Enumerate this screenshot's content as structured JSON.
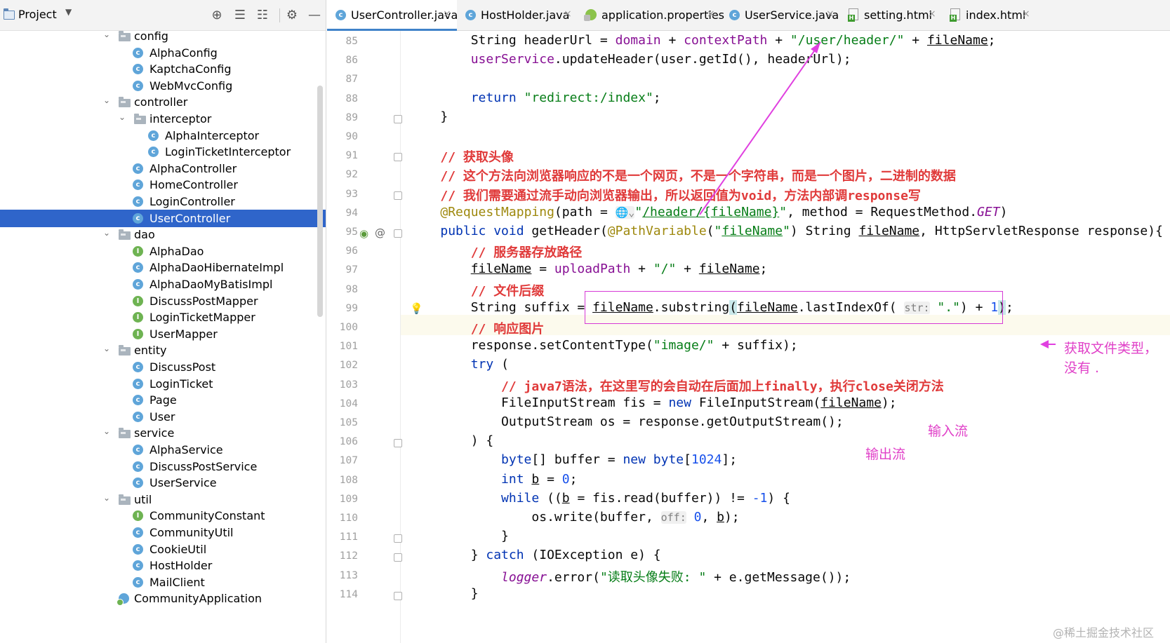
{
  "project_panel": {
    "title": "Project",
    "dropdown": "▼",
    "toolbar": [
      {
        "name": "locate-icon",
        "glyph": "⊕"
      },
      {
        "name": "expand-all-icon",
        "glyph": "☰"
      },
      {
        "name": "collapse-all-icon",
        "glyph": "☷"
      },
      {
        "name": "gear-icon",
        "glyph": "⚙"
      },
      {
        "name": "minimize-icon",
        "glyph": "—"
      }
    ],
    "tree": [
      {
        "label": "config",
        "type": "folder",
        "level": 1,
        "expanded": true
      },
      {
        "label": "AlphaConfig",
        "type": "class",
        "level": 2
      },
      {
        "label": "KaptchaConfig",
        "type": "class",
        "level": 2
      },
      {
        "label": "WebMvcConfig",
        "type": "class",
        "level": 2
      },
      {
        "label": "controller",
        "type": "folder",
        "level": 1,
        "expanded": true
      },
      {
        "label": "interceptor",
        "type": "folder",
        "level": 2,
        "expanded": true
      },
      {
        "label": "AlphaInterceptor",
        "type": "class",
        "level": 3
      },
      {
        "label": "LoginTicketInterceptor",
        "type": "class",
        "level": 3
      },
      {
        "label": "AlphaController",
        "type": "class",
        "level": 2
      },
      {
        "label": "HomeController",
        "type": "class",
        "level": 2
      },
      {
        "label": "LoginController",
        "type": "class",
        "level": 2
      },
      {
        "label": "UserController",
        "type": "class",
        "level": 2,
        "selected": true
      },
      {
        "label": "dao",
        "type": "folder",
        "level": 1,
        "expanded": true
      },
      {
        "label": "AlphaDao",
        "type": "interface",
        "level": 2
      },
      {
        "label": "AlphaDaoHibernateImpl",
        "type": "class",
        "level": 2
      },
      {
        "label": "AlphaDaoMyBatisImpl",
        "type": "class",
        "level": 2
      },
      {
        "label": "DiscussPostMapper",
        "type": "interface",
        "level": 2
      },
      {
        "label": "LoginTicketMapper",
        "type": "interface",
        "level": 2
      },
      {
        "label": "UserMapper",
        "type": "interface",
        "level": 2
      },
      {
        "label": "entity",
        "type": "folder",
        "level": 1,
        "expanded": true
      },
      {
        "label": "DiscussPost",
        "type": "class",
        "level": 2
      },
      {
        "label": "LoginTicket",
        "type": "class",
        "level": 2
      },
      {
        "label": "Page",
        "type": "class",
        "level": 2
      },
      {
        "label": "User",
        "type": "class",
        "level": 2
      },
      {
        "label": "service",
        "type": "folder",
        "level": 1,
        "expanded": true
      },
      {
        "label": "AlphaService",
        "type": "class",
        "level": 2
      },
      {
        "label": "DiscussPostService",
        "type": "class",
        "level": 2
      },
      {
        "label": "UserService",
        "type": "class",
        "level": 2
      },
      {
        "label": "util",
        "type": "folder",
        "level": 1,
        "expanded": true
      },
      {
        "label": "CommunityConstant",
        "type": "interface",
        "level": 2
      },
      {
        "label": "CommunityUtil",
        "type": "class",
        "level": 2
      },
      {
        "label": "CookieUtil",
        "type": "class",
        "level": 2
      },
      {
        "label": "HostHolder",
        "type": "class",
        "level": 2
      },
      {
        "label": "MailClient",
        "type": "class",
        "level": 2
      },
      {
        "label": "CommunityApplication",
        "type": "app",
        "level": 1
      }
    ]
  },
  "tabs": [
    {
      "label": "UserController.java",
      "icon": "class",
      "active": true
    },
    {
      "label": "HostHolder.java",
      "icon": "class"
    },
    {
      "label": "application.properties",
      "icon": "properties"
    },
    {
      "label": "UserService.java",
      "icon": "class"
    },
    {
      "label": "setting.html",
      "icon": "html"
    },
    {
      "label": "index.html",
      "icon": "html"
    }
  ],
  "editor": {
    "lines": [
      {
        "n": "85",
        "code": [
          [
            "",
            "        String headerUrl = "
          ],
          [
            "fld",
            "domain"
          ],
          [
            "",
            " + "
          ],
          [
            "fld",
            "contextPath"
          ],
          [
            "",
            " + "
          ],
          [
            "str",
            "\"/user/header/\""
          ],
          [
            "",
            " + "
          ],
          [
            "ul",
            "fileName"
          ],
          [
            "",
            ";"
          ]
        ]
      },
      {
        "n": "86",
        "code": [
          [
            "",
            "        "
          ],
          [
            "fld",
            "userService"
          ],
          [
            "",
            ".updateHeader(user.getId(), headerUrl);"
          ]
        ]
      },
      {
        "n": "87",
        "code": [
          [
            "",
            ""
          ]
        ]
      },
      {
        "n": "88",
        "code": [
          [
            "",
            "        "
          ],
          [
            "kw",
            "return "
          ],
          [
            "str",
            "\"redirect:/index\""
          ],
          [
            "",
            ";"
          ]
        ]
      },
      {
        "n": "89",
        "code": [
          [
            "",
            "    }"
          ]
        ]
      },
      {
        "n": "90",
        "code": [
          [
            "",
            ""
          ]
        ]
      },
      {
        "n": "91",
        "code": [
          [
            "",
            "    "
          ],
          [
            "cmt",
            "// 获取头像"
          ]
        ]
      },
      {
        "n": "92",
        "code": [
          [
            "",
            "    "
          ],
          [
            "cmt",
            "// 这个方法向浏览器响应的不是一个网页，不是一个字符串，而是一个图片，二进制的数据"
          ]
        ]
      },
      {
        "n": "93",
        "code": [
          [
            "",
            "    "
          ],
          [
            "cmt",
            "// 我们需要通过流手动向浏览器输出，所以返回值为void，方法内部调response写"
          ]
        ]
      },
      {
        "n": "94",
        "code": [
          [
            "",
            "    "
          ],
          [
            "ann",
            "@RequestMapping"
          ],
          [
            "",
            "(path = "
          ],
          [
            "hint",
            "🌐⌄"
          ],
          [
            "str",
            "\""
          ],
          [
            "str ul",
            "/header/{fileName}"
          ],
          [
            "str",
            "\""
          ],
          [
            "",
            ", method = RequestMethod."
          ],
          [
            "fld it",
            "GET"
          ],
          [
            "",
            ")"
          ]
        ]
      },
      {
        "n": "95",
        "code": [
          [
            "",
            "    "
          ],
          [
            "kw",
            "public void "
          ],
          [
            "",
            "getHeader("
          ],
          [
            "ann",
            "@PathVariable"
          ],
          [
            "",
            "("
          ],
          [
            "str",
            "\""
          ],
          [
            "str ul",
            "fileName"
          ],
          [
            "str",
            "\""
          ],
          [
            "",
            ") String "
          ],
          [
            "ul",
            "fileName"
          ],
          [
            "",
            ", HttpServletResponse response){"
          ]
        ]
      },
      {
        "n": "96",
        "code": [
          [
            "",
            "        "
          ],
          [
            "cmt",
            "// 服务器存放路径"
          ]
        ]
      },
      {
        "n": "97",
        "code": [
          [
            "",
            "        "
          ],
          [
            "ul",
            "fileName"
          ],
          [
            "",
            " = "
          ],
          [
            "fld",
            "uploadPath"
          ],
          [
            "",
            " + "
          ],
          [
            "str",
            "\"/\""
          ],
          [
            "",
            " + "
          ],
          [
            "ul",
            "fileName"
          ],
          [
            "",
            ";"
          ]
        ]
      },
      {
        "n": "98",
        "code": [
          [
            "",
            "        "
          ],
          [
            "cmt",
            "// 文件后缀"
          ]
        ]
      },
      {
        "n": "99",
        "code": [
          [
            "",
            "        String suffix = "
          ],
          [
            "ul",
            "fileName"
          ],
          [
            "",
            ".substring"
          ],
          [
            "brace-hl",
            "("
          ],
          [
            "ul",
            "fileName"
          ],
          [
            "",
            ".lastIndexOf( "
          ],
          [
            "hint",
            "str:"
          ],
          [
            "",
            ""
          ],
          [
            "str",
            " \".\""
          ],
          [
            "",
            ") + "
          ],
          [
            "num",
            "1"
          ],
          [
            "brace-hl",
            ")"
          ],
          [
            "",
            ";"
          ]
        ]
      },
      {
        "n": "100",
        "code": [
          [
            "",
            "        "
          ],
          [
            "cmt",
            "// 响应图片"
          ]
        ]
      },
      {
        "n": "101",
        "code": [
          [
            "",
            "        response.setContentType("
          ],
          [
            "str",
            "\"image/\""
          ],
          [
            "",
            " + suffix);"
          ]
        ]
      },
      {
        "n": "102",
        "code": [
          [
            "",
            "        "
          ],
          [
            "kw",
            "try "
          ],
          [
            "",
            "("
          ]
        ]
      },
      {
        "n": "103",
        "code": [
          [
            "",
            "            "
          ],
          [
            "cmt",
            "// java7语法，在这里写的会自动在后面加上finally，执行close关闭方法"
          ]
        ]
      },
      {
        "n": "104",
        "code": [
          [
            "",
            "            FileInputStream fis = "
          ],
          [
            "kw",
            "new "
          ],
          [
            "",
            "FileInputStream("
          ],
          [
            "ul",
            "fileName"
          ],
          [
            "",
            ");"
          ]
        ]
      },
      {
        "n": "105",
        "code": [
          [
            "",
            "            OutputStream os = response.getOutputStream();"
          ]
        ]
      },
      {
        "n": "106",
        "code": [
          [
            "",
            "        ) {"
          ]
        ]
      },
      {
        "n": "107",
        "code": [
          [
            "",
            "            "
          ],
          [
            "kw",
            "byte"
          ],
          [
            "",
            "[] buffer = "
          ],
          [
            "kw",
            "new byte"
          ],
          [
            "",
            "["
          ],
          [
            "num",
            "1024"
          ],
          [
            "",
            "];"
          ]
        ]
      },
      {
        "n": "108",
        "code": [
          [
            "",
            "            "
          ],
          [
            "kw",
            "int "
          ],
          [
            "ul",
            "b"
          ],
          [
            "",
            " = "
          ],
          [
            "num",
            "0"
          ],
          [
            "",
            ";"
          ]
        ]
      },
      {
        "n": "109",
        "code": [
          [
            "",
            "            "
          ],
          [
            "kw",
            "while "
          ],
          [
            "",
            "(("
          ],
          [
            "ul",
            "b"
          ],
          [
            "",
            " = fis.read(buffer)) != "
          ],
          [
            "num",
            "-1"
          ],
          [
            "",
            ") {"
          ]
        ]
      },
      {
        "n": "110",
        "code": [
          [
            "",
            "                os.write(buffer, "
          ],
          [
            "hint",
            "off:"
          ],
          [
            "",
            " "
          ],
          [
            "num",
            "0"
          ],
          [
            "",
            ", "
          ],
          [
            "ul",
            "b"
          ],
          [
            "",
            ");"
          ]
        ]
      },
      {
        "n": "111",
        "code": [
          [
            "",
            "            }"
          ]
        ]
      },
      {
        "n": "112",
        "code": [
          [
            "",
            "        } "
          ],
          [
            "kw",
            "catch "
          ],
          [
            "",
            "(IOException e) {"
          ]
        ]
      },
      {
        "n": "113",
        "code": [
          [
            "",
            "            "
          ],
          [
            "fld it",
            "logger"
          ],
          [
            "",
            ".error("
          ],
          [
            "str",
            "\"读取头像失败: \""
          ],
          [
            "",
            " + e.getMessage());"
          ]
        ]
      },
      {
        "n": "114",
        "code": [
          [
            "",
            "        }"
          ]
        ]
      }
    ]
  },
  "annotations": {
    "file_type_line1": "获取文件类型，",
    "file_type_line2": "没有 .",
    "input_stream": "输入流",
    "output_stream": "输出流",
    "arrow_color": "#e040e0"
  },
  "watermark": "@稀土掘金技术社区",
  "colors": {
    "selection": "#2f65ca",
    "keyword": "#0033b3",
    "string": "#067d17",
    "comment": "#e03a3a",
    "field": "#871094",
    "annotation": "#9e880d",
    "number": "#1750eb",
    "annotation_ink": "#e040c8"
  }
}
